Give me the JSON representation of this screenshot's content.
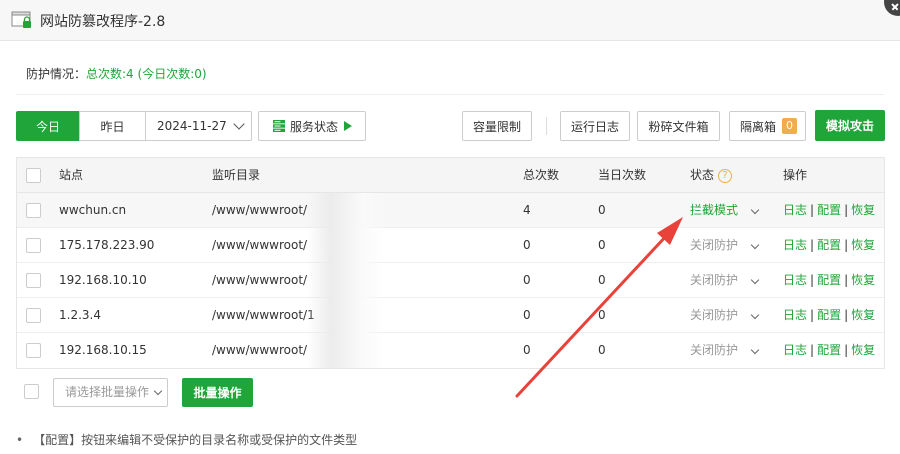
{
  "window": {
    "title": "网站防篡改程序-2.8"
  },
  "protect": {
    "label": "防护情况：",
    "summary": "总次数:4 (今日次数:0)"
  },
  "toolbar": {
    "today": "今日",
    "yesterday": "昨日",
    "date": "2024-11-27",
    "service_status": "服务状态",
    "capacity": "容量限制",
    "run_log": "运行日志",
    "shred_box": "粉碎文件箱",
    "isolation": "隔离箱",
    "isolation_count": "0",
    "simulate_attack": "模拟攻击"
  },
  "table": {
    "headers": {
      "site": "站点",
      "dir": "监听目录",
      "total": "总次数",
      "today": "当日次数",
      "status": "状态",
      "ops": "操作"
    },
    "rows": [
      {
        "site": "wwchun.cn",
        "dir": "/www/wwwroot/",
        "total": "4",
        "today": "0",
        "status": "拦截模式"
      },
      {
        "site": "175.178.223.90",
        "dir": "/www/wwwroot/",
        "total": "0",
        "today": "0",
        "status": "关闭防护"
      },
      {
        "site": "192.168.10.10",
        "dir": "/www/wwwroot/",
        "total": "0",
        "today": "0",
        "status": "关闭防护"
      },
      {
        "site": "1.2.3.4",
        "dir": "/www/wwwroot/1",
        "total": "0",
        "today": "0",
        "status": "关闭防护"
      },
      {
        "site": "192.168.10.15",
        "dir": "/www/wwwroot/",
        "total": "0",
        "today": "0",
        "status": "关闭防护"
      }
    ],
    "ops": {
      "log": "日志",
      "config": "配置",
      "restore": "恢复"
    }
  },
  "batch": {
    "placeholder": "请选择批量操作",
    "button": "批量操作"
  },
  "note": "【配置】按钮来编辑不受保护的目录名称或受保护的文件类型",
  "colors": {
    "accent": "#20a53a",
    "arrow": "#e8423a",
    "badge": "#f0ad4e"
  }
}
